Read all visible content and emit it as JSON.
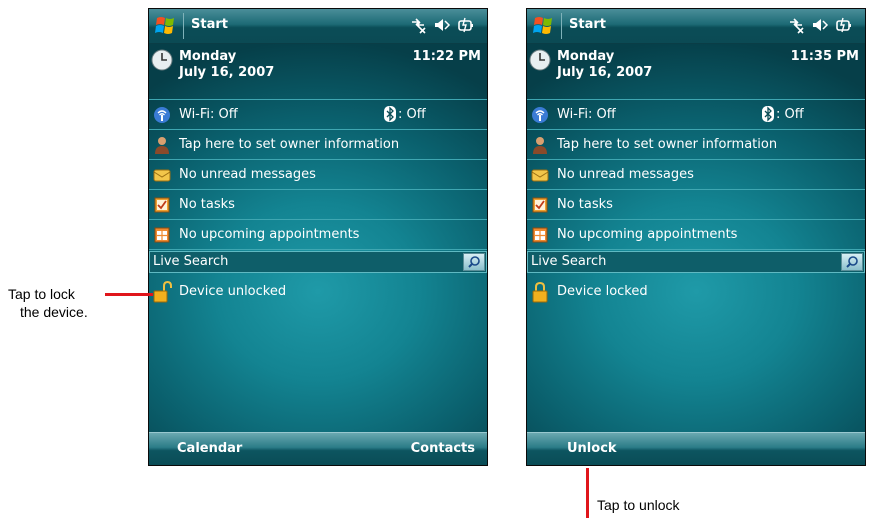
{
  "callouts": {
    "lock_line1": "Tap to lock",
    "lock_line2": "the device.",
    "unlock": "Tap to unlock"
  },
  "colors": {
    "callout_line": "#e0151b",
    "screen_bg": "#138492",
    "text": "#ffffff"
  },
  "screens": {
    "left": {
      "title": "Start",
      "day": "Monday",
      "date": "July 16, 2007",
      "time": "11:22 PM",
      "wifi": "Wi-Fi: Off",
      "bluetooth": ": Off",
      "owner": "Tap here to set owner information",
      "messages": "No unread messages",
      "tasks": "No tasks",
      "appointments": "No upcoming appointments",
      "search": "Live Search",
      "lock_status": "Device unlocked",
      "lock_icon": "padlock-open-icon",
      "softkey_left": "Calendar",
      "softkey_right": "Contacts"
    },
    "right": {
      "title": "Start",
      "day": "Monday",
      "date": "July 16, 2007",
      "time": "11:35 PM",
      "wifi": "Wi-Fi: Off",
      "bluetooth": ": Off",
      "owner": "Tap here to set owner information",
      "messages": "No unread messages",
      "tasks": "No tasks",
      "appointments": "No upcoming appointments",
      "search": "Live Search",
      "lock_status": "Device locked",
      "lock_icon": "padlock-closed-icon",
      "softkey_center": "Unlock"
    }
  }
}
